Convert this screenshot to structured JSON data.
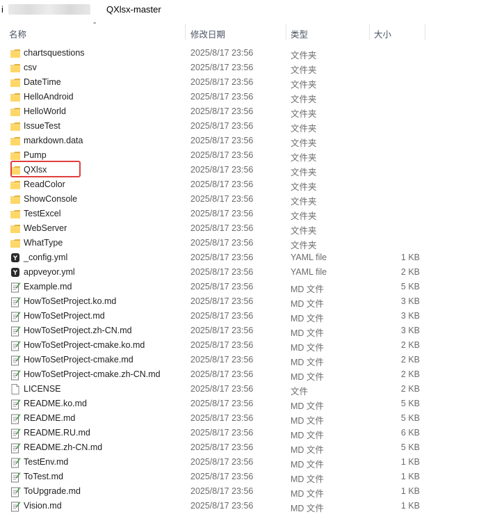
{
  "window": {
    "title_prefix": "i",
    "title": "QXlsx-master"
  },
  "columns": {
    "name": "名称",
    "date": "修改日期",
    "type": "类型",
    "size": "大小"
  },
  "colors": {
    "folder": "#FFD767",
    "highlight": "#E03E3E"
  },
  "files": [
    {
      "name": "chartsquestions",
      "date": "2025/8/17 23:56",
      "type": "文件夹",
      "size": "",
      "icon": "folder-icon"
    },
    {
      "name": "csv",
      "date": "2025/8/17 23:56",
      "type": "文件夹",
      "size": "",
      "icon": "folder-icon"
    },
    {
      "name": "DateTime",
      "date": "2025/8/17 23:56",
      "type": "文件夹",
      "size": "",
      "icon": "folder-icon"
    },
    {
      "name": "HelloAndroid",
      "date": "2025/8/17 23:56",
      "type": "文件夹",
      "size": "",
      "icon": "folder-icon"
    },
    {
      "name": "HelloWorld",
      "date": "2025/8/17 23:56",
      "type": "文件夹",
      "size": "",
      "icon": "folder-icon"
    },
    {
      "name": "IssueTest",
      "date": "2025/8/17 23:56",
      "type": "文件夹",
      "size": "",
      "icon": "folder-icon"
    },
    {
      "name": "markdown.data",
      "date": "2025/8/17 23:56",
      "type": "文件夹",
      "size": "",
      "icon": "folder-icon"
    },
    {
      "name": "Pump",
      "date": "2025/8/17 23:56",
      "type": "文件夹",
      "size": "",
      "icon": "folder-icon"
    },
    {
      "name": "QXlsx",
      "date": "2025/8/17 23:56",
      "type": "文件夹",
      "size": "",
      "icon": "folder-icon",
      "highlighted": true
    },
    {
      "name": "ReadColor",
      "date": "2025/8/17 23:56",
      "type": "文件夹",
      "size": "",
      "icon": "folder-icon"
    },
    {
      "name": "ShowConsole",
      "date": "2025/8/17 23:56",
      "type": "文件夹",
      "size": "",
      "icon": "folder-icon"
    },
    {
      "name": "TestExcel",
      "date": "2025/8/17 23:56",
      "type": "文件夹",
      "size": "",
      "icon": "folder-icon"
    },
    {
      "name": "WebServer",
      "date": "2025/8/17 23:56",
      "type": "文件夹",
      "size": "",
      "icon": "folder-icon"
    },
    {
      "name": "WhatType",
      "date": "2025/8/17 23:56",
      "type": "文件夹",
      "size": "",
      "icon": "folder-icon"
    },
    {
      "name": "_config.yml",
      "date": "2025/8/17 23:56",
      "type": "YAML file",
      "size": "1 KB",
      "icon": "yaml-file-icon"
    },
    {
      "name": "appveyor.yml",
      "date": "2025/8/17 23:56",
      "type": "YAML file",
      "size": "2 KB",
      "icon": "yaml-file-icon"
    },
    {
      "name": "Example.md",
      "date": "2025/8/17 23:56",
      "type": "MD 文件",
      "size": "5 KB",
      "icon": "markdown-file-icon"
    },
    {
      "name": "HowToSetProject.ko.md",
      "date": "2025/8/17 23:56",
      "type": "MD 文件",
      "size": "3 KB",
      "icon": "markdown-file-icon"
    },
    {
      "name": "HowToSetProject.md",
      "date": "2025/8/17 23:56",
      "type": "MD 文件",
      "size": "3 KB",
      "icon": "markdown-file-icon"
    },
    {
      "name": "HowToSetProject.zh-CN.md",
      "date": "2025/8/17 23:56",
      "type": "MD 文件",
      "size": "3 KB",
      "icon": "markdown-file-icon"
    },
    {
      "name": "HowToSetProject-cmake.ko.md",
      "date": "2025/8/17 23:56",
      "type": "MD 文件",
      "size": "2 KB",
      "icon": "markdown-file-icon"
    },
    {
      "name": "HowToSetProject-cmake.md",
      "date": "2025/8/17 23:56",
      "type": "MD 文件",
      "size": "2 KB",
      "icon": "markdown-file-icon"
    },
    {
      "name": "HowToSetProject-cmake.zh-CN.md",
      "date": "2025/8/17 23:56",
      "type": "MD 文件",
      "size": "2 KB",
      "icon": "markdown-file-icon"
    },
    {
      "name": "LICENSE",
      "date": "2025/8/17 23:56",
      "type": "文件",
      "size": "2 KB",
      "icon": "blank-file-icon"
    },
    {
      "name": "README.ko.md",
      "date": "2025/8/17 23:56",
      "type": "MD 文件",
      "size": "5 KB",
      "icon": "markdown-file-icon"
    },
    {
      "name": "README.md",
      "date": "2025/8/17 23:56",
      "type": "MD 文件",
      "size": "5 KB",
      "icon": "markdown-file-icon"
    },
    {
      "name": "README.RU.md",
      "date": "2025/8/17 23:56",
      "type": "MD 文件",
      "size": "6 KB",
      "icon": "markdown-file-icon"
    },
    {
      "name": "README.zh-CN.md",
      "date": "2025/8/17 23:56",
      "type": "MD 文件",
      "size": "5 KB",
      "icon": "markdown-file-icon"
    },
    {
      "name": "TestEnv.md",
      "date": "2025/8/17 23:56",
      "type": "MD 文件",
      "size": "1 KB",
      "icon": "markdown-file-icon"
    },
    {
      "name": "ToTest.md",
      "date": "2025/8/17 23:56",
      "type": "MD 文件",
      "size": "1 KB",
      "icon": "markdown-file-icon"
    },
    {
      "name": "ToUpgrade.md",
      "date": "2025/8/17 23:56",
      "type": "MD 文件",
      "size": "1 KB",
      "icon": "markdown-file-icon"
    },
    {
      "name": "Vision.md",
      "date": "2025/8/17 23:56",
      "type": "MD 文件",
      "size": "1 KB",
      "icon": "markdown-file-icon"
    }
  ]
}
